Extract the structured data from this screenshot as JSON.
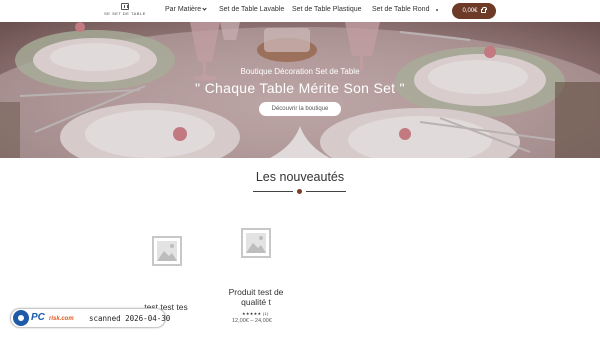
{
  "header": {
    "logo_text": "Se Set de Table",
    "nav": [
      {
        "label": "Par Matière",
        "has_dropdown": true
      },
      {
        "label": "Set de Table Lavable"
      },
      {
        "label": "Set de Table Plastique"
      },
      {
        "label": "Set de Table Rond"
      }
    ],
    "cart_label": "0,00€",
    "cart_icon": "shopping-bag-icon"
  },
  "hero": {
    "subtitle": "Boutique Décoration Set de Table",
    "title": "\" Chaque Table Mérite Son Set \"",
    "button_label": "Découvrir la boutique"
  },
  "section": {
    "title": "Les nouveautés"
  },
  "products": [
    {
      "title": "test test tes",
      "icon": "image-placeholder-icon"
    },
    {
      "title_line1": "Produit test de",
      "title_line2": "qualité t",
      "rating_stars": "★★★★★",
      "rating_count": "(1)",
      "price": "12,00€ – 24,00€",
      "icon": "image-placeholder-icon"
    }
  ],
  "watermark": {
    "brand_pc": "PC",
    "brand_risk": "risk.com",
    "scan_text": "scanned 2026-04-30"
  },
  "colors": {
    "accent": "#6e3a28",
    "dot": "#7a3e26"
  }
}
